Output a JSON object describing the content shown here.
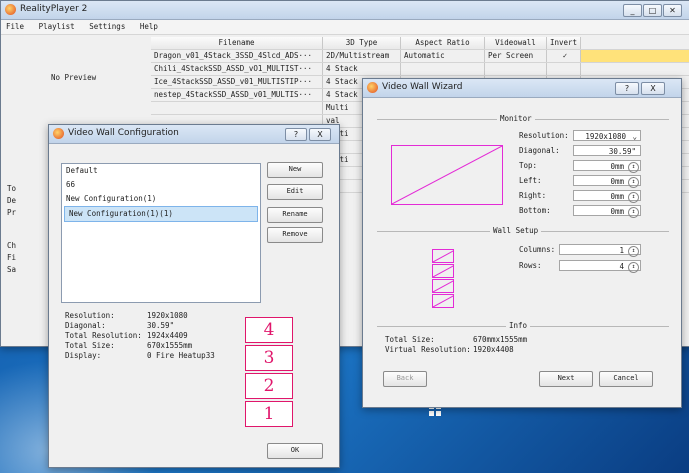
{
  "main": {
    "title": "RealityPlayer 2",
    "menu": [
      "File",
      "Playlist",
      "Settings",
      "Help"
    ],
    "preview_label": "No Preview",
    "left_letters": [
      "To",
      "De",
      "Pr",
      "Ch",
      "Fi",
      "Sa"
    ],
    "headers": [
      "Filename",
      "3D Type",
      "Aspect Ratio",
      "Videowall",
      "Invert"
    ],
    "rows": [
      {
        "filename": "Dragon_v01_4Stack_3SSD_4Slcd_ADS···",
        "type": "2D/Multistream",
        "aspect": "Automatic",
        "videowall": "Per Screen",
        "invert": "✓"
      },
      {
        "filename": "Chili_4StackSSD_ASSD_vO1_MULTIST···",
        "type": "4 Stack",
        "aspect": "",
        "videowall": "",
        "invert": ""
      },
      {
        "filename": "Ice_4StackSSD_ASSD_v01_MULTISTIP···",
        "type": "4 Stack",
        "aspect": "",
        "videowall": "",
        "invert": ""
      },
      {
        "filename": "nestep_4StackSSD_ASSD_v01_MULTIS···",
        "type": "4 Stack",
        "aspect": "",
        "videowall": "",
        "invert": ""
      },
      {
        "filename": "",
        "type": "Multi",
        "aspect": "",
        "videowall": "",
        "invert": ""
      },
      {
        "filename": "",
        "type": "val",
        "aspect": "",
        "videowall": "",
        "invert": ""
      },
      {
        "filename": "",
        "type": "Multi",
        "aspect": "",
        "videowall": "",
        "invert": ""
      },
      {
        "filename": "",
        "type": "val",
        "aspect": "",
        "videowall": "",
        "invert": ""
      },
      {
        "filename": "",
        "type": "Multi",
        "aspect": "",
        "videowall": "",
        "invert": ""
      },
      {
        "filename": "",
        "type": "val",
        "aspect": "",
        "videowall": "",
        "invert": ""
      },
      {
        "filename": "",
        "type": "val",
        "aspect": "",
        "videowall": "",
        "invert": ""
      }
    ]
  },
  "config": {
    "title": "Video Wall Configuration",
    "help_btn": "?",
    "close_btn": "X",
    "items": [
      "Default",
      "66",
      "New Configuration(1)",
      "New Configuration(1)(1)"
    ],
    "selected_index": 3,
    "buttons": {
      "new": "New",
      "edit": "Edit",
      "rename": "Rename",
      "remove": "Remove",
      "ok": "OK"
    },
    "info": [
      {
        "label": "Resolution:",
        "value": "1920x1080"
      },
      {
        "label": "Diagonal:",
        "value": "30.59\""
      },
      {
        "label": "Total Resolution:",
        "value": "1924x4409"
      },
      {
        "label": "Total Size:",
        "value": "670x1555mm"
      },
      {
        "label": "Display:",
        "value": "0 Fire Heatup33"
      }
    ],
    "stack": [
      "4",
      "3",
      "2",
      "1"
    ]
  },
  "wizard": {
    "title": "Video Wall Wizard",
    "help_btn": "?",
    "close_btn": "X",
    "monitor_group": "Monitor",
    "wall_group": "Wall Setup",
    "info_group": "Info",
    "fields": [
      {
        "label": "Resolution:",
        "value": "1920x1080"
      },
      {
        "label": "Diagonal:",
        "value": "30.59\""
      },
      {
        "label": "Top:",
        "value": "0mm"
      },
      {
        "label": "Left:",
        "value": "0mm"
      },
      {
        "label": "Right:",
        "value": "0mm"
      },
      {
        "label": "Bottom:",
        "value": "0mm"
      }
    ],
    "columns_label": "Columns:",
    "columns_value": "1",
    "rows_label": "Rows:",
    "rows_value": "4",
    "total_size_label": "Total Size:",
    "total_size_value": "670mmx1555mm",
    "virtual_res_label": "Virtual Resolution:",
    "virtual_res_value": "1920x4408",
    "back_btn": "Back",
    "next_btn": "Next",
    "cancel_btn": "Cancel"
  },
  "colors": {
    "accent_pink": "#e0166b",
    "accent_magenta": "#e32bd6",
    "selected_row": "#ffe27a"
  }
}
